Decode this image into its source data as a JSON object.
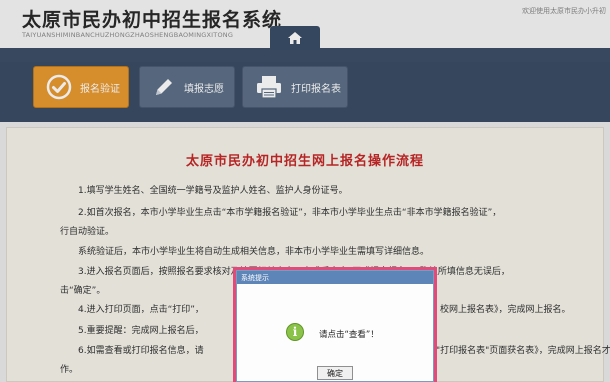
{
  "header": {
    "title": "太原市民办初中招生报名系统",
    "title_pinyin": "TAIYUANSHIMINBANCHUZHONGZHAOSHENGBAOMINGXITONG",
    "welcome_text": "欢迎使用太原市民办小升初"
  },
  "toolbar": {
    "enroll_label": "报名验证",
    "fill_label": "填报志愿",
    "print_label": "打印报名表"
  },
  "content": {
    "title": "太原市民办初中招生网上报名操作流程",
    "lines": [
      "1.填写学生姓名、全国统一学籍号及监护人姓名、监护人身份证号。",
      "2.如首次报名，本市小学毕业生点击“本市学籍报名验证”，非本市小学毕业生点击“非本市学籍报名验证”，",
      "行自动验证。",
      "系统验证后，本市小学毕业生将自动生成相关信息，非本市小学毕业生需填写详细信息。",
      "3.进入报名页面后，按照报名要求核对及填写相关内容，完成后点击“正式提交报名”，确认所填信息无误后，",
      "击“确定”。",
      "4.进入打印页面，点击“打印”，",
      "5.重要提醒：完成网上报名后，",
      "6.如需查看或打印报名信息，请",
      "作。"
    ],
    "line4_tail": "校网上报名表》，完成网上报名。",
    "line6_tail": "\"打印报名表\"页面获名表》，完成网上报名才"
  },
  "dialog": {
    "title": "系统提示",
    "message": "请点击“查看”！",
    "ok_label": "确定"
  },
  "colors": {
    "nav_bg": "#3b4d65",
    "active_button": "#e99a2f",
    "title_red": "#c62828",
    "dialog_highlight": "#e24a7a"
  }
}
